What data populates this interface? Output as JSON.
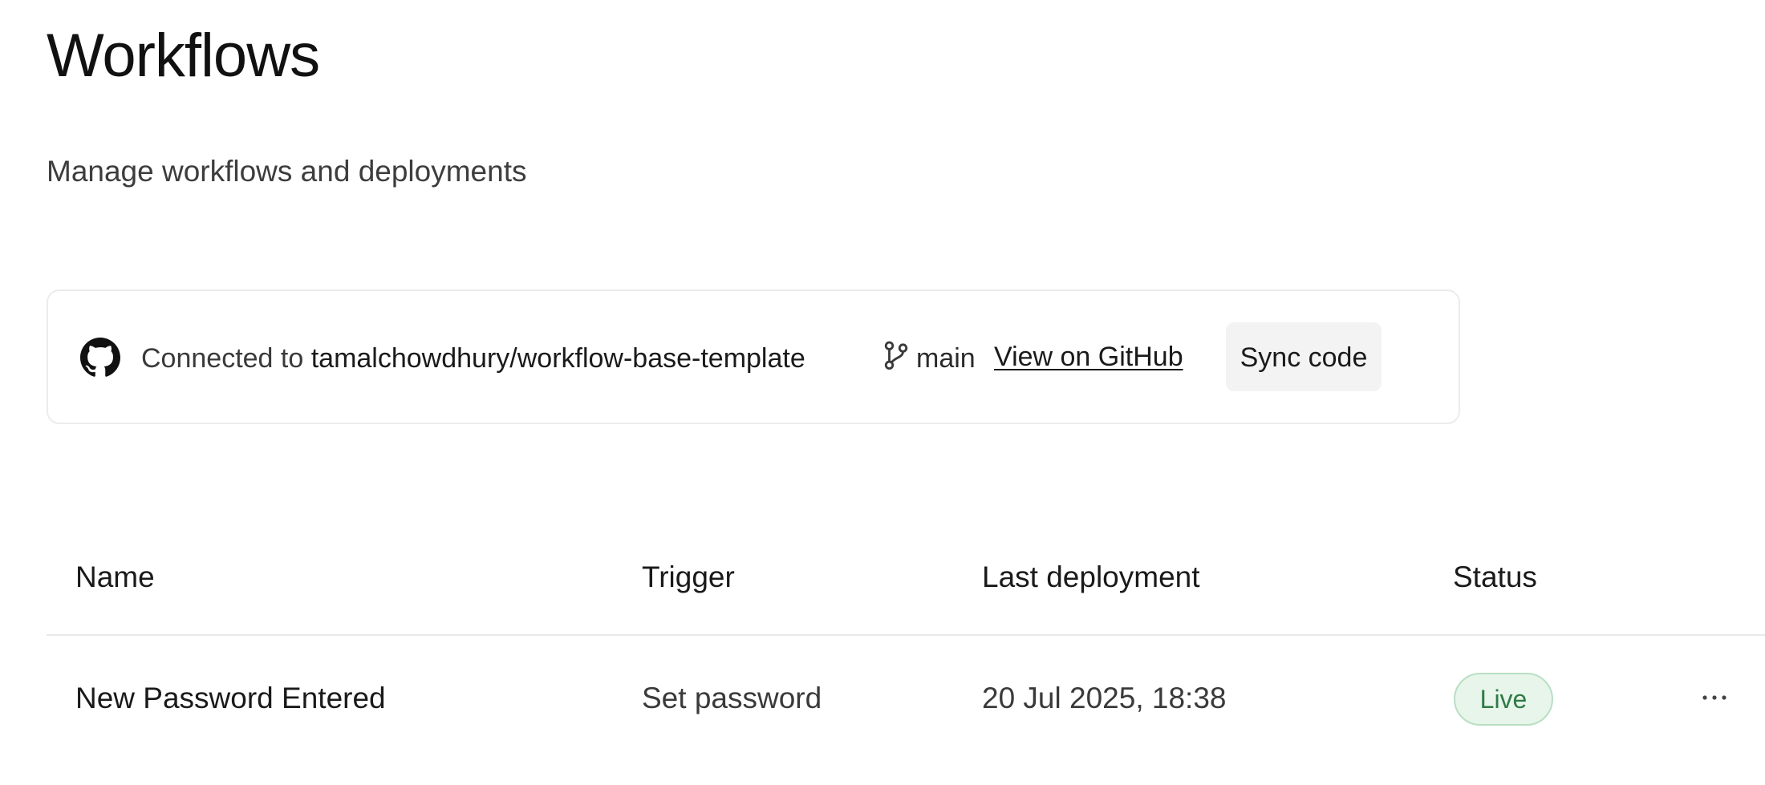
{
  "header": {
    "title": "Workflows",
    "subtitle": "Manage workflows and deployments"
  },
  "repo": {
    "connected_prefix": "Connected to",
    "repository": "tamalchowdhury/workflow-base-template",
    "branch": "main",
    "github_link": "View on GitHub",
    "sync_button": "Sync code",
    "icons": [
      "github-icon",
      "git-branch-icon"
    ]
  },
  "table": {
    "columns": [
      "Name",
      "Trigger",
      "Last deployment",
      "Status"
    ],
    "rows": [
      {
        "name": "New Password Entered",
        "trigger": "Set password",
        "last_deployment": "20 Jul 2025, 18:38",
        "status": "Live",
        "actions_icon": "more-horizontal-icon"
      }
    ]
  },
  "colors": {
    "status_live_bg": "#e7f5ea",
    "status_live_text": "#2f7a45",
    "status_live_border": "#b9dfc3",
    "button_bg": "#f3f3f3"
  }
}
